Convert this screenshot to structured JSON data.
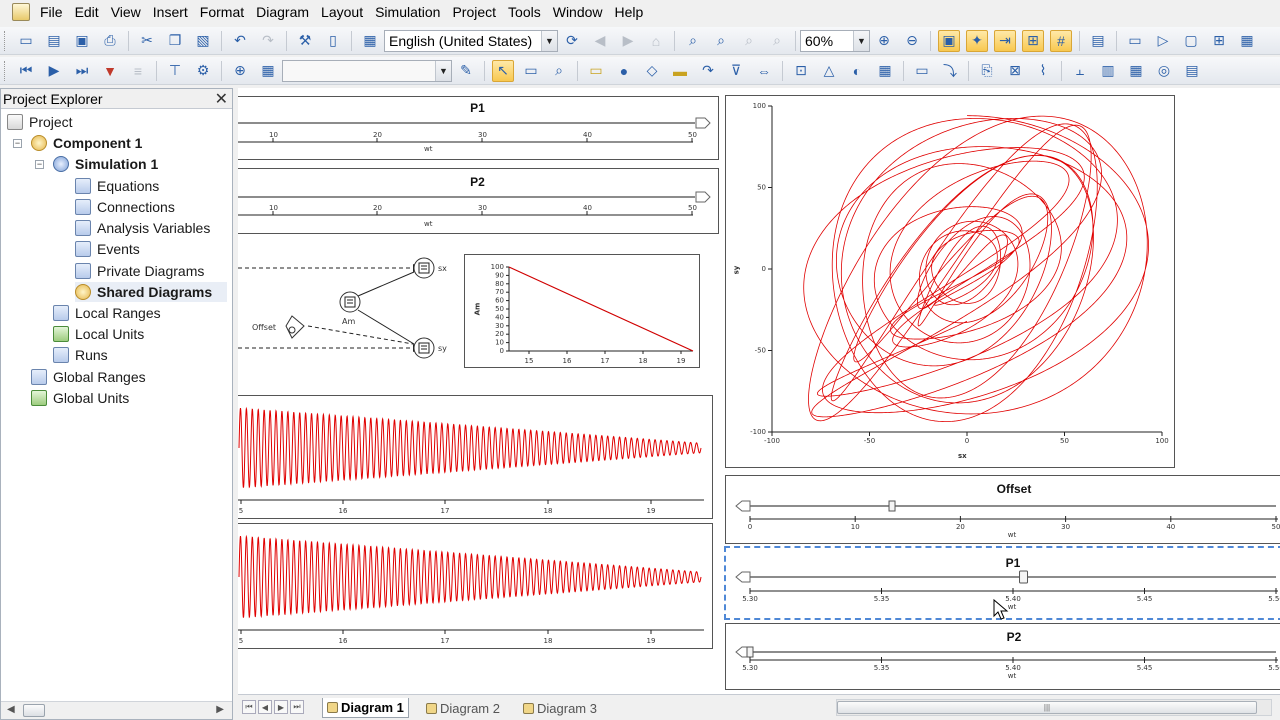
{
  "menu": [
    "File",
    "Edit",
    "View",
    "Insert",
    "Format",
    "Diagram",
    "Layout",
    "Simulation",
    "Project",
    "Tools",
    "Window",
    "Help"
  ],
  "toolbar": {
    "language": "English (United States)",
    "zoom": "60%"
  },
  "explorer": {
    "title": "Project Explorer",
    "nodes": [
      {
        "label": "Project"
      },
      {
        "label": "Component 1"
      },
      {
        "label": "Simulation 1"
      },
      {
        "label": "Equations"
      },
      {
        "label": "Connections"
      },
      {
        "label": "Analysis Variables"
      },
      {
        "label": "Events"
      },
      {
        "label": "Private Diagrams"
      },
      {
        "label": "Shared Diagrams"
      },
      {
        "label": "Local Ranges"
      },
      {
        "label": "Local Units"
      },
      {
        "label": "Runs"
      },
      {
        "label": "Global Ranges"
      },
      {
        "label": "Global Units"
      }
    ]
  },
  "diagram": {
    "p1_slider": {
      "title": "P1",
      "xlabel": "wt",
      "ticks": [
        "10",
        "20",
        "30",
        "40",
        "50"
      ]
    },
    "p2_slider": {
      "title": "P2",
      "xlabel": "wt",
      "ticks": [
        "10",
        "20",
        "30",
        "40",
        "50"
      ]
    },
    "node_labels": {
      "sx": "sx",
      "sy": "sy",
      "am": "Am",
      "offset": "Offset"
    },
    "am_plot": {
      "ylabel": "Am",
      "yticks": [
        "100",
        "90",
        "80",
        "70",
        "60",
        "50",
        "40",
        "30",
        "20",
        "10",
        "0"
      ],
      "xticks": [
        "15",
        "16",
        "17",
        "18",
        "19"
      ]
    },
    "wave_ticks": [
      "5",
      "16",
      "17",
      "18",
      "19"
    ],
    "xy_plot": {
      "xlabel": "sx",
      "ylabel": "sy",
      "xticks": [
        "-100",
        "-50",
        "0",
        "50",
        "100"
      ],
      "yticks": [
        "100",
        "50",
        "0",
        "-50",
        "-100"
      ]
    },
    "offset_slider": {
      "title": "Offset",
      "xlabel": "wt",
      "ticks": [
        "0",
        "10",
        "20",
        "30",
        "40",
        "50"
      ],
      "value": 0.27
    },
    "p1_slider2": {
      "title": "P1",
      "xlabel": "wt",
      "ticks": [
        "5.30",
        "5.35",
        "5.40",
        "5.45",
        "5.50"
      ],
      "value": 0.52
    },
    "p2_slider2": {
      "title": "P2",
      "xlabel": "wt",
      "ticks": [
        "5.30",
        "5.35",
        "5.40",
        "5.45",
        "5.50"
      ],
      "value": 0.0
    }
  },
  "tabs": [
    "Diagram 1",
    "Diagram 2",
    "Diagram 3"
  ],
  "chart_data": [
    {
      "type": "line",
      "ylabel": "Am",
      "xlim": [
        14.5,
        19.5
      ],
      "ylim": [
        0,
        100
      ],
      "series": [
        {
          "x": [
            14.5,
            19.5
          ],
          "values": [
            100,
            0
          ]
        }
      ],
      "color": "#d00000"
    },
    {
      "type": "line",
      "xlim": [
        14.5,
        19.5
      ],
      "series": [
        {
          "kind": "decaying oscillation",
          "amplitude_start": 1.0,
          "amplitude_end": 0.12
        }
      ],
      "color": "#e00000"
    },
    {
      "type": "line",
      "xlim": [
        14.5,
        19.5
      ],
      "series": [
        {
          "kind": "decaying oscillation",
          "amplitude_start": 1.0,
          "amplitude_end": 0.12
        }
      ],
      "color": "#e00000"
    },
    {
      "type": "line",
      "xlabel": "sx",
      "ylabel": "sy",
      "xlim": [
        -100,
        100
      ],
      "ylim": [
        -100,
        100
      ],
      "series": [
        {
          "kind": "lissajous"
        }
      ],
      "color": "#e00000"
    }
  ]
}
